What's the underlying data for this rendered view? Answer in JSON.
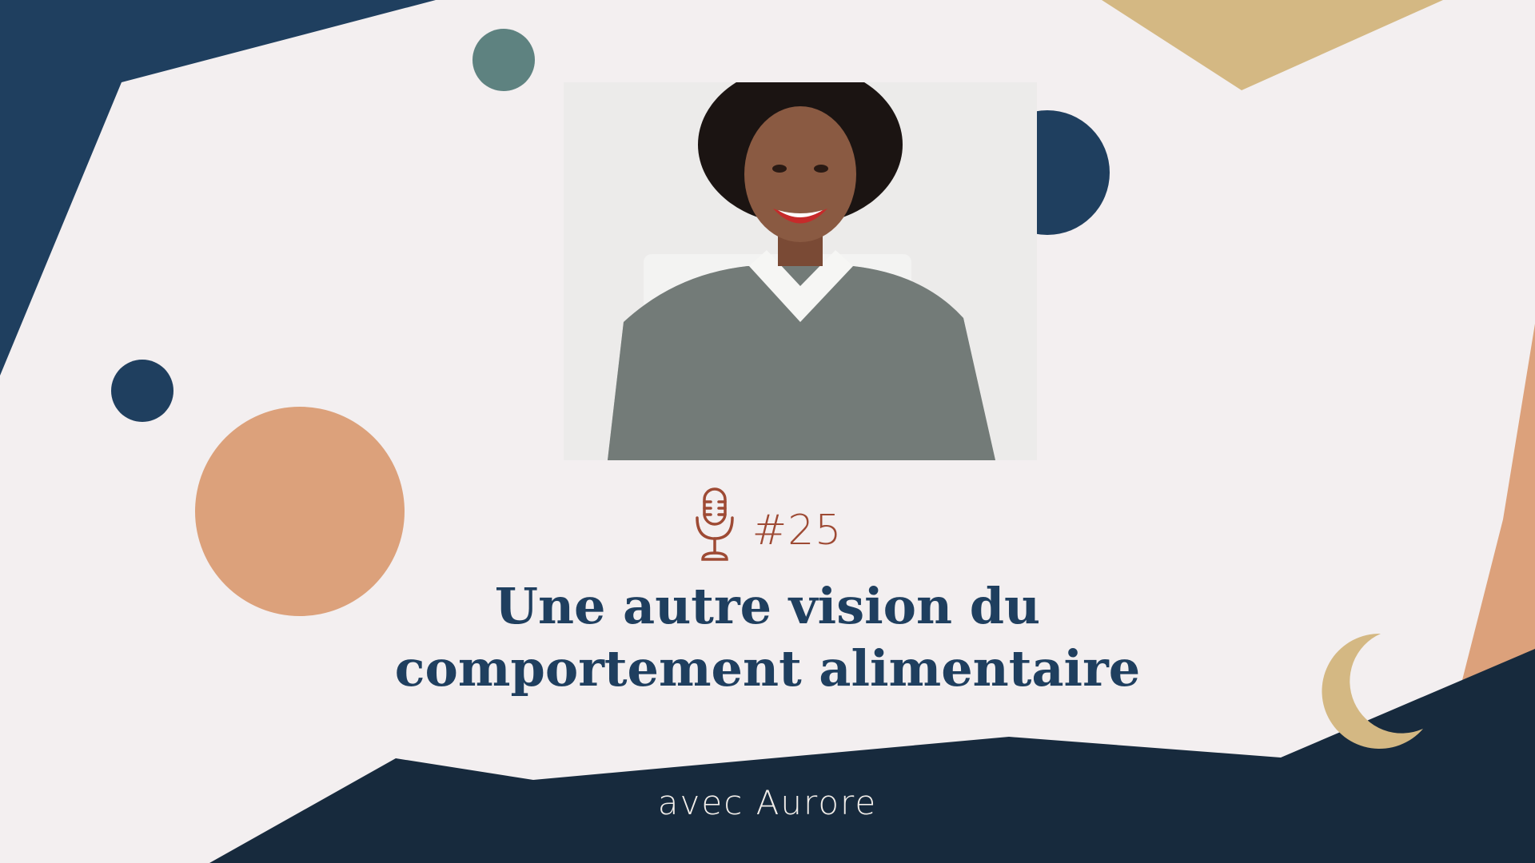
{
  "episode": {
    "icon": "microphone-icon",
    "number": "#25"
  },
  "title": {
    "line1": "Une autre vision du",
    "line2": "comportement alimentaire"
  },
  "host_line": "avec Aurore",
  "photo": {
    "subject": "portrait-photo"
  },
  "colors": {
    "background": "#f3eff0",
    "navy": "#1f3f5f",
    "dark_navy": "#172a3d",
    "sand": "#d4b883",
    "peach": "#dca17b",
    "teal": "#5e8280",
    "accent_rust": "#9e4a34"
  }
}
